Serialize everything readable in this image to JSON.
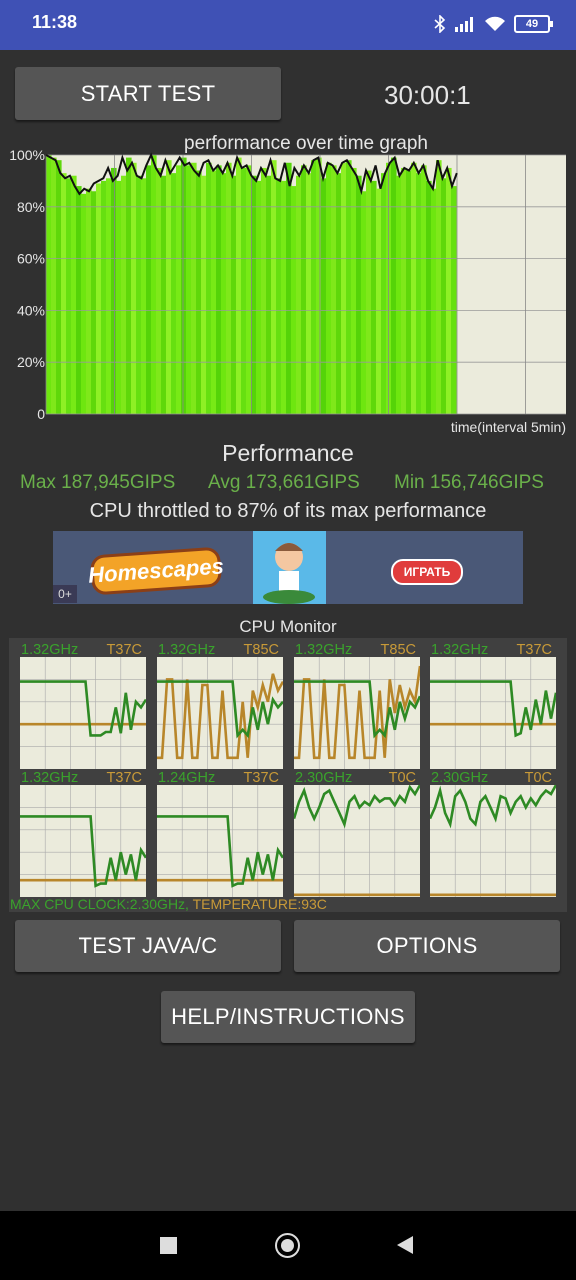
{
  "status_bar": {
    "time": "11:38",
    "battery": "49",
    "icons": [
      "bluetooth-icon",
      "signal-icon",
      "wifi-icon",
      "battery-icon"
    ]
  },
  "toolbar": {
    "start_label": "START TEST",
    "timer": "30:00:1"
  },
  "graph": {
    "title": "performance over time graph",
    "y_ticks": [
      "100%",
      "80%",
      "60%",
      "40%",
      "20%",
      "0"
    ],
    "x_label": "time(interval 5min)"
  },
  "chart_data": {
    "type": "area",
    "title": "performance over time graph",
    "xlabel": "time(interval 5min)",
    "ylabel": "",
    "ylim": [
      0,
      100
    ],
    "grid": true,
    "filled_fraction": 0.79,
    "values": [
      100,
      99,
      98,
      93,
      91,
      92,
      88,
      85,
      87,
      86,
      89,
      90,
      91,
      95,
      90,
      92,
      99,
      94,
      97,
      92,
      91,
      96,
      100,
      95,
      92,
      98,
      93,
      96,
      99,
      96,
      97,
      94,
      92,
      97,
      98,
      94,
      96,
      93,
      97,
      92,
      99,
      95,
      96,
      92,
      90,
      95,
      92,
      98,
      91,
      90,
      97,
      88,
      95,
      92,
      96,
      93,
      98,
      99,
      91,
      97,
      96,
      93,
      97,
      98,
      95,
      92,
      86,
      94,
      90,
      96,
      87,
      93,
      97,
      99,
      92,
      95,
      94,
      97,
      93,
      96,
      90,
      87,
      98,
      91,
      95,
      88,
      93
    ]
  },
  "performance": {
    "label": "Performance",
    "max": "Max 187,945GIPS",
    "avg": "Avg 173,661GIPS",
    "min": "Min 156,746GIPS",
    "throttle": "CPU throttled to 87% of its max performance"
  },
  "ad": {
    "brand": "Homescapes",
    "cta": "ИГРАТЬ",
    "age": "0+"
  },
  "cpu_monitor": {
    "title": "CPU Monitor",
    "cores": [
      {
        "freq": "1.32GHz",
        "temp": "T37C",
        "freq_series": [
          0.78,
          0.78,
          0.78,
          0.78,
          0.78,
          0.78,
          0.78,
          0.78,
          0.78,
          0.78,
          0.78,
          0.78,
          0.78,
          0.78,
          0.3,
          0.3,
          0.3,
          0.33,
          0.33,
          0.55,
          0.32,
          0.68,
          0.35,
          0.6,
          0.55,
          0.62
        ],
        "temp_series": [
          0.4,
          0.4,
          0.4,
          0.4,
          0.4,
          0.4,
          0.4,
          0.4,
          0.4,
          0.4,
          0.4,
          0.4,
          0.4,
          0.4,
          0.4,
          0.4,
          0.4,
          0.4,
          0.4,
          0.4,
          0.4,
          0.4,
          0.4,
          0.4,
          0.4,
          0.4
        ]
      },
      {
        "freq": "1.32GHz",
        "temp": "T85C",
        "freq_series": [
          0.78,
          0.78,
          0.78,
          0.78,
          0.78,
          0.78,
          0.78,
          0.78,
          0.78,
          0.78,
          0.78,
          0.78,
          0.78,
          0.78,
          0.78,
          0.78,
          0.3,
          0.35,
          0.3,
          0.55,
          0.35,
          0.6,
          0.4,
          0.62,
          0.55,
          0.6
        ],
        "temp_series": [
          0.1,
          0.1,
          0.8,
          0.8,
          0.1,
          0.1,
          0.8,
          0.1,
          0.1,
          0.75,
          0.75,
          0.1,
          0.1,
          0.7,
          0.1,
          0.1,
          0.1,
          0.6,
          0.1,
          0.7,
          0.55,
          0.75,
          0.6,
          0.85,
          0.7,
          0.78
        ]
      },
      {
        "freq": "1.32GHz",
        "temp": "T85C",
        "freq_series": [
          0.78,
          0.78,
          0.78,
          0.78,
          0.78,
          0.78,
          0.78,
          0.78,
          0.78,
          0.78,
          0.78,
          0.78,
          0.78,
          0.78,
          0.78,
          0.78,
          0.3,
          0.35,
          0.3,
          0.55,
          0.35,
          0.6,
          0.45,
          0.6,
          0.55,
          0.65
        ],
        "temp_series": [
          0.1,
          0.1,
          0.8,
          0.8,
          0.1,
          0.1,
          0.8,
          0.1,
          0.1,
          0.75,
          0.75,
          0.1,
          0.1,
          0.7,
          0.1,
          0.1,
          0.1,
          0.7,
          0.1,
          0.8,
          0.5,
          0.75,
          0.55,
          0.7,
          0.6,
          0.92
        ]
      },
      {
        "freq": "1.32GHz",
        "temp": "T37C",
        "freq_series": [
          0.78,
          0.78,
          0.78,
          0.78,
          0.78,
          0.78,
          0.78,
          0.78,
          0.78,
          0.78,
          0.78,
          0.78,
          0.78,
          0.78,
          0.78,
          0.78,
          0.78,
          0.3,
          0.32,
          0.55,
          0.35,
          0.62,
          0.4,
          0.7,
          0.45,
          0.68
        ],
        "temp_series": [
          0.4,
          0.4,
          0.4,
          0.4,
          0.4,
          0.4,
          0.4,
          0.4,
          0.4,
          0.4,
          0.4,
          0.4,
          0.4,
          0.4,
          0.4,
          0.4,
          0.4,
          0.4,
          0.4,
          0.4,
          0.4,
          0.4,
          0.4,
          0.4,
          0.4,
          0.4
        ]
      },
      {
        "freq": "1.32GHz",
        "temp": "T37C",
        "freq_series": [
          0.72,
          0.72,
          0.72,
          0.72,
          0.72,
          0.72,
          0.72,
          0.72,
          0.72,
          0.72,
          0.72,
          0.72,
          0.72,
          0.72,
          0.72,
          0.1,
          0.12,
          0.12,
          0.35,
          0.15,
          0.4,
          0.2,
          0.38,
          0.15,
          0.42,
          0.35
        ],
        "temp_series": [
          0.15,
          0.15,
          0.15,
          0.15,
          0.15,
          0.15,
          0.15,
          0.15,
          0.15,
          0.15,
          0.15,
          0.15,
          0.15,
          0.15,
          0.15,
          0.15,
          0.15,
          0.15,
          0.15,
          0.15,
          0.15,
          0.15,
          0.15,
          0.15,
          0.15,
          0.15
        ]
      },
      {
        "freq": "1.24GHz",
        "temp": "T37C",
        "freq_series": [
          0.72,
          0.72,
          0.72,
          0.72,
          0.72,
          0.72,
          0.72,
          0.72,
          0.72,
          0.72,
          0.72,
          0.72,
          0.72,
          0.72,
          0.72,
          0.1,
          0.12,
          0.12,
          0.35,
          0.15,
          0.4,
          0.2,
          0.38,
          0.15,
          0.42,
          0.35
        ],
        "temp_series": [
          0.15,
          0.15,
          0.15,
          0.15,
          0.15,
          0.15,
          0.15,
          0.15,
          0.15,
          0.15,
          0.15,
          0.15,
          0.15,
          0.15,
          0.15,
          0.15,
          0.15,
          0.15,
          0.15,
          0.15,
          0.15,
          0.15,
          0.15,
          0.15,
          0.15,
          0.15
        ]
      },
      {
        "freq": "2.30GHz",
        "temp": "T0C",
        "freq_series": [
          0.7,
          0.85,
          0.95,
          0.8,
          0.7,
          0.8,
          0.92,
          0.95,
          0.85,
          0.75,
          0.65,
          0.85,
          0.9,
          0.8,
          0.85,
          0.82,
          0.9,
          0.85,
          0.88,
          0.88,
          0.82,
          0.9,
          0.85,
          0.98,
          0.92,
          1.0
        ],
        "temp_series": [
          0.02,
          0.02,
          0.02,
          0.02,
          0.02,
          0.02,
          0.02,
          0.02,
          0.02,
          0.02,
          0.02,
          0.02,
          0.02,
          0.02,
          0.02,
          0.02,
          0.02,
          0.02,
          0.02,
          0.02,
          0.02,
          0.02,
          0.02,
          0.02,
          0.02,
          0.02
        ]
      },
      {
        "freq": "2.30GHz",
        "temp": "T0C",
        "freq_series": [
          0.7,
          0.8,
          0.95,
          0.75,
          0.65,
          0.9,
          0.95,
          0.85,
          0.7,
          0.65,
          0.85,
          0.9,
          0.8,
          0.7,
          0.9,
          0.88,
          0.75,
          0.85,
          0.9,
          0.8,
          0.88,
          0.82,
          0.9,
          0.95,
          0.92,
          1.0
        ],
        "temp_series": [
          0.02,
          0.02,
          0.02,
          0.02,
          0.02,
          0.02,
          0.02,
          0.02,
          0.02,
          0.02,
          0.02,
          0.02,
          0.02,
          0.02,
          0.02,
          0.02,
          0.02,
          0.02,
          0.02,
          0.02,
          0.02,
          0.02,
          0.02,
          0.02,
          0.02,
          0.02
        ]
      }
    ],
    "max_clock": "MAX CPU CLOCK:2.30GHz,",
    "temperature": "TEMPERATURE:93C"
  },
  "buttons": {
    "test_java": "TEST JAVA/C",
    "options": "OPTIONS",
    "help": "HELP/INSTRUCTIONS"
  },
  "colors": {
    "status_bar": "#3f51b5",
    "background": "#303030",
    "green": "#3aa32c",
    "orange": "#c89a38",
    "graph_fill": "#6ee60f"
  }
}
